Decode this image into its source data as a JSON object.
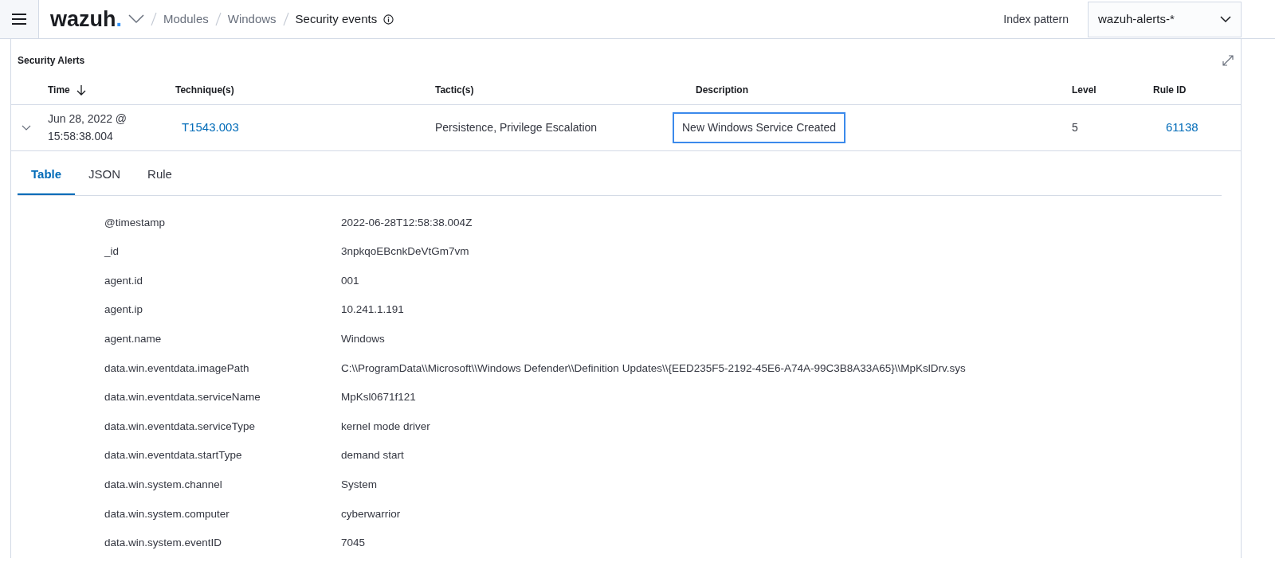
{
  "header": {
    "logo": "wazuh.",
    "breadcrumbs": [
      {
        "label": "Modules",
        "current": false
      },
      {
        "label": "Windows",
        "current": false
      },
      {
        "label": "Security events",
        "current": true
      }
    ],
    "index_pattern": {
      "label": "Index pattern",
      "value": "wazuh-alerts-*"
    }
  },
  "panel": {
    "title": "Security Alerts",
    "columns": [
      {
        "label": "Time",
        "sorted": true
      },
      {
        "label": "Technique(s)",
        "sorted": false
      },
      {
        "label": "Tactic(s)",
        "sorted": false
      },
      {
        "label": "Description",
        "sorted": false
      },
      {
        "label": "Level",
        "sorted": false
      },
      {
        "label": "Rule ID",
        "sorted": false
      }
    ],
    "rows": [
      {
        "expanded": true,
        "time": "Jun 28, 2022 @ 15:58:38.004",
        "technique": "T1543.003",
        "tactic": "Persistence, Privilege Escalation",
        "description": {
          "text": "New Windows Service Created",
          "focused": true
        },
        "level": "5",
        "rule_id": "61138"
      }
    ],
    "tabs": [
      {
        "label": "Table",
        "selected": true
      },
      {
        "label": "JSON",
        "selected": false
      },
      {
        "label": "Rule",
        "selected": false
      }
    ],
    "fields": [
      {
        "key": "@timestamp",
        "value": "2022-06-28T12:58:38.004Z"
      },
      {
        "key": "_id",
        "value": "3npkqoEBcnkDeVtGm7vm"
      },
      {
        "key": "agent.id",
        "value": "001"
      },
      {
        "key": "agent.ip",
        "value": "10.241.1.191"
      },
      {
        "key": "agent.name",
        "value": "Windows"
      },
      {
        "key": "data.win.eventdata.imagePath",
        "value": "C:\\\\ProgramData\\\\Microsoft\\\\Windows Defender\\\\Definition Updates\\\\{EED235F5-2192-45E6-A74A-99C3B8A33A65}\\\\MpKslDrv.sys"
      },
      {
        "key": "data.win.eventdata.serviceName",
        "value": "MpKsl0671f121"
      },
      {
        "key": "data.win.eventdata.serviceType",
        "value": "kernel mode driver"
      },
      {
        "key": "data.win.eventdata.startType",
        "value": "demand start"
      },
      {
        "key": "data.win.system.channel",
        "value": "System"
      },
      {
        "key": "data.win.system.computer",
        "value": "cyberwarrior"
      },
      {
        "key": "data.win.system.eventID",
        "value": "7045"
      }
    ]
  }
}
